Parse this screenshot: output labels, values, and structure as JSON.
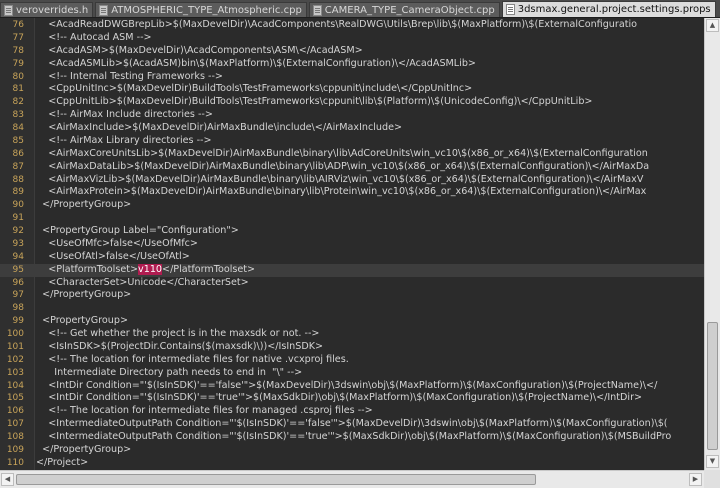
{
  "tabs": [
    {
      "label": "veroverrides.h",
      "active": false
    },
    {
      "label": "ATMOSPHERIC_TYPE_Atmospheric.cpp",
      "active": false
    },
    {
      "label": "CAMERA_TYPE_CameraObject.cpp",
      "active": false
    },
    {
      "label": "3dsmax.general.project.settings.props",
      "active": true
    }
  ],
  "editor": {
    "current_line": 95,
    "selection": "v110",
    "lines": [
      {
        "num": "76",
        "text": "    <AcadReadDWGBrepLib>$(MaxDevelDir)\\AcadComponents\\RealDWG\\Utils\\Brep\\lib\\$(MaxPlatform)\\$(ExternalConfiguratio"
      },
      {
        "num": "77",
        "text": "    <!-- Autocad ASM -->"
      },
      {
        "num": "78",
        "text": "    <AcadASM>$(MaxDevelDir)\\AcadComponents\\ASM\\</AcadASM>"
      },
      {
        "num": "79",
        "text": "    <AcadASMLib>$(AcadASM)bin\\$(MaxPlatform)\\$(ExternalConfiguration)\\</AcadASMLib>"
      },
      {
        "num": "80",
        "text": "    <!-- Internal Testing Frameworks -->"
      },
      {
        "num": "81",
        "text": "    <CppUnitInc>$(MaxDevelDir)BuildTools\\TestFrameworks\\cppunit\\include\\</CppUnitInc>"
      },
      {
        "num": "82",
        "text": "    <CppUnitLib>$(MaxDevelDir)BuildTools\\TestFrameworks\\cppunit\\lib\\$(Platform)\\$(UnicodeConfig)\\</CppUnitLib>"
      },
      {
        "num": "83",
        "text": "    <!-- AirMax Include directories -->"
      },
      {
        "num": "84",
        "text": "    <AirMaxInclude>$(MaxDevelDir)AirMaxBundle\\include\\</AirMaxInclude>"
      },
      {
        "num": "85",
        "text": "    <!-- AirMax Library directories -->"
      },
      {
        "num": "86",
        "text": "    <AirMaxCoreUnitsLib>$(MaxDevelDir)AirMaxBundle\\binary\\lib\\AdCoreUnits\\win_vc10\\$(x86_or_x64)\\$(ExternalConfiguration"
      },
      {
        "num": "87",
        "text": "    <AirMaxDataLib>$(MaxDevelDir)AirMaxBundle\\binary\\lib\\ADP\\win_vc10\\$(x86_or_x64)\\$(ExternalConfiguration)\\</AirMaxDa"
      },
      {
        "num": "88",
        "text": "    <AirMaxVizLib>$(MaxDevelDir)AirMaxBundle\\binary\\lib\\AIRViz\\win_vc10\\$(x86_or_x64)\\$(ExternalConfiguration)\\</AirMaxV"
      },
      {
        "num": "89",
        "text": "    <AirMaxProtein>$(MaxDevelDir)AirMaxBundle\\binary\\lib\\Protein\\win_vc10\\$(x86_or_x64)\\$(ExternalConfiguration)\\</AirMax"
      },
      {
        "num": "90",
        "text": "  </PropertyGroup>"
      },
      {
        "num": "91",
        "text": ""
      },
      {
        "num": "92",
        "text": "  <PropertyGroup Label=\"Configuration\">"
      },
      {
        "num": "93",
        "text": "    <UseOfMfc>false</UseOfMfc>"
      },
      {
        "num": "94",
        "text": "    <UseOfAtl>false</UseOfAtl>"
      },
      {
        "num": "95",
        "before": "    <PlatformToolset>",
        "selected": "v110",
        "after": "</PlatformToolset>"
      },
      {
        "num": "96",
        "text": "    <CharacterSet>Unicode</CharacterSet>"
      },
      {
        "num": "97",
        "text": "  </PropertyGroup>"
      },
      {
        "num": "98",
        "text": ""
      },
      {
        "num": "99",
        "text": "  <PropertyGroup>"
      },
      {
        "num": "100",
        "text": "    <!-- Get whether the project is in the maxsdk or not. -->"
      },
      {
        "num": "101",
        "text": "    <IsInSDK>$(ProjectDir.Contains($(maxsdk)\\))</IsInSDK>"
      },
      {
        "num": "102",
        "text": "    <!-- The location for intermediate files for native .vcxproj files."
      },
      {
        "num": "103",
        "text": "      Intermediate Directory path needs to end in  \"\\\" -->"
      },
      {
        "num": "104",
        "text": "    <IntDir Condition=\"'$(IsInSDK)'=='false'\">$(MaxDevelDir)\\3dswin\\obj\\$(MaxPlatform)\\$(MaxConfiguration)\\$(ProjectName)\\</"
      },
      {
        "num": "105",
        "text": "    <IntDir Condition=\"'$(IsInSDK)'=='true'\">$(MaxSdkDir)\\obj\\$(MaxPlatform)\\$(MaxConfiguration)\\$(ProjectName)\\</IntDir>"
      },
      {
        "num": "106",
        "text": "    <!-- The location for intermediate files for managed .csproj files -->"
      },
      {
        "num": "107",
        "text": "    <IntermediateOutputPath Condition=\"'$(IsInSDK)'=='false'\">$(MaxDevelDir)\\3dswin\\obj\\$(MaxPlatform)\\$(MaxConfiguration)\\$("
      },
      {
        "num": "108",
        "text": "    <IntermediateOutputPath Condition=\"'$(IsInSDK)'=='true'\">$(MaxSdkDir)\\obj\\$(MaxPlatform)\\$(MaxConfiguration)\\$(MSBuildPro"
      },
      {
        "num": "109",
        "text": "  </PropertyGroup>"
      },
      {
        "num": "110",
        "text": "</Project>"
      }
    ]
  }
}
